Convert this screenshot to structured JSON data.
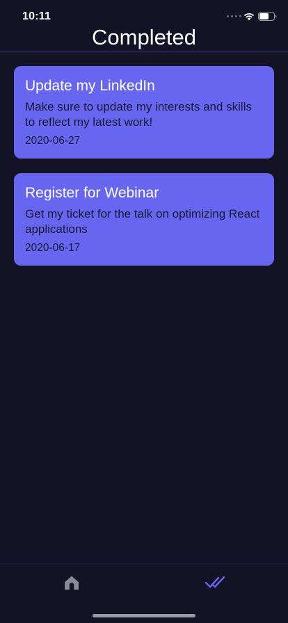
{
  "status_bar": {
    "time": "10:11"
  },
  "header": {
    "title": "Completed"
  },
  "tasks": [
    {
      "title": "Update my LinkedIn",
      "description": "Make sure to update my interests and skills to reflect my latest work!",
      "date": "2020-06-27"
    },
    {
      "title": "Register for Webinar",
      "description": "Get my ticket for the talk on optimizing React applications",
      "date": "2020-06-17"
    }
  ],
  "tab_bar": {
    "items": [
      {
        "icon": "home-icon",
        "active": false
      },
      {
        "icon": "double-check-icon",
        "active": true
      }
    ],
    "active_color": "#6666f0",
    "inactive_color": "#8a8a94"
  },
  "colors": {
    "background": "#131325",
    "card": "#6666f0",
    "card_text_dark": "#1a1a33"
  }
}
